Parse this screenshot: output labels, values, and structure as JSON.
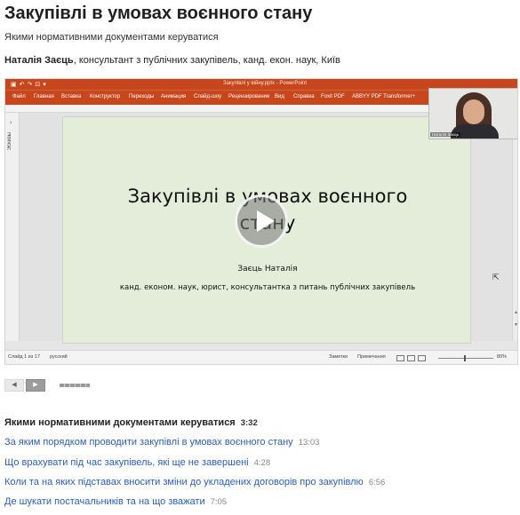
{
  "page": {
    "title": "Закупівлі в умовах воєнного стану",
    "subtitle": "Якими нормативними документами керуватися",
    "author": {
      "name": "Наталія Заєць",
      "description": ", консультант з публічних закупівель, канд. екон. наук, Київ"
    }
  },
  "video": {
    "powerpoint": {
      "filename": "Закупівлі у війну.pptx - PowerPoint",
      "ribbon_tabs": [
        "Файл",
        "Главная",
        "Вставка",
        "Конструктор",
        "Переходы",
        "Анимация",
        "Слайд-шоу",
        "Рецензирование",
        "Вид",
        "Справка",
        "Foxit PDF",
        "ABBYY PDF Transformer+"
      ],
      "sidebar_label": "Эскизы",
      "status_left": "Слайд 1 из 17",
      "status_language": "русский",
      "status_notes": "Заметки",
      "status_comments": "Примечания",
      "zoom": "80%"
    },
    "slide": {
      "title_line1": "Закупівлі в умовах воєнного",
      "title_line2": "стану",
      "author": "Заєць Наталія",
      "description": "канд. економ. наук, юрист, консультантка з питань публічних закупівель"
    },
    "webcam_label": "Наталія Заєць"
  },
  "navigation": {
    "prev_icon": "◀",
    "next_icon": "▶"
  },
  "chapters": [
    {
      "title": "Якими нормативними документами керуватися",
      "time": "3:32",
      "current": true
    },
    {
      "title": "За яким порядком проводити закупівлі в умовах воєнного стану",
      "time": "13:03",
      "current": false
    },
    {
      "title": "Що врахувати під час закупівель, які ще не завершені",
      "time": "4:28",
      "current": false
    },
    {
      "title": "Коли та на яких підставах вносити зміни до укладених договорів про закупівлю",
      "time": "6:56",
      "current": false
    },
    {
      "title": "Де шукати постачальників та на що зважати",
      "time": "7:05",
      "current": false
    }
  ],
  "colors": {
    "ribbon": "#c7461c",
    "slide_bg": "#e4ecda",
    "link": "#2b5fb4"
  }
}
